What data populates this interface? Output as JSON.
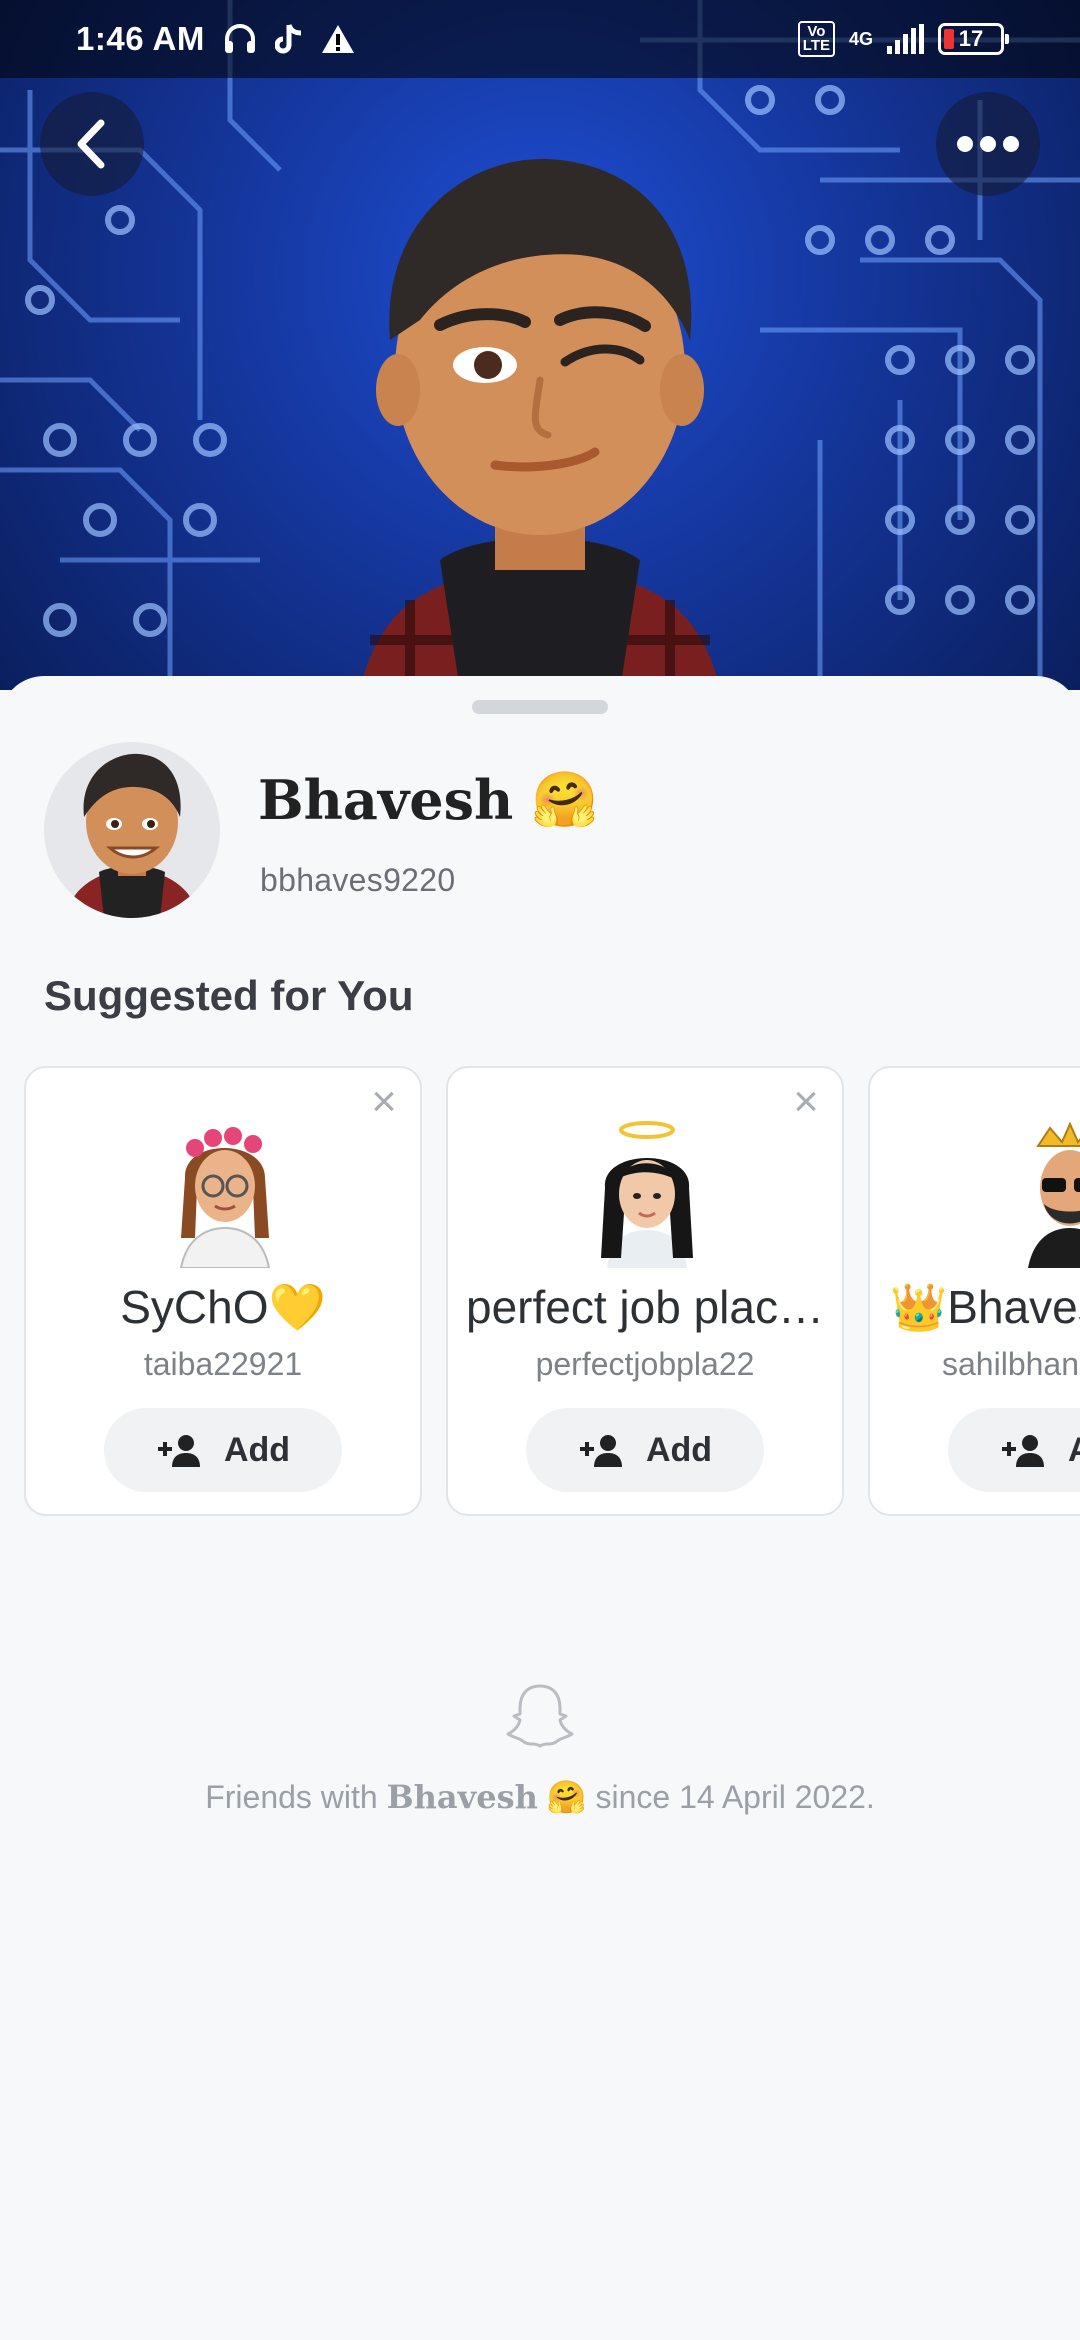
{
  "status_bar": {
    "time": "1:46 AM",
    "network": "4G",
    "volte_top": "Vo",
    "volte_bottom": "LTE",
    "battery": "17"
  },
  "header": {
    "back_icon": "chevron-left-icon",
    "more_icon": "more-horizontal-icon"
  },
  "profile": {
    "display_name": "Bhavesh",
    "name_emoji": "🤗",
    "username": "bbhaves9220"
  },
  "suggested": {
    "title": "Suggested for You",
    "cards": [
      {
        "name": "SyChO💛",
        "username": "taiba22921",
        "add_label": "Add"
      },
      {
        "name": "perfect job plac…",
        "username": "perfectjobpla22",
        "add_label": "Add"
      },
      {
        "name": "👑Bhaves",
        "username": "sahilbhan",
        "add_label": "A"
      }
    ]
  },
  "footer": {
    "prefix": "Friends with ",
    "name": "Bhavesh",
    "emoji": "🤗",
    "suffix": " since 14 April 2022."
  },
  "colors": {
    "hero_blue": "#1f4fd6",
    "sheet_bg": "#f7f8fa",
    "text_dark": "#2d3035",
    "text_muted": "#7d8288"
  }
}
